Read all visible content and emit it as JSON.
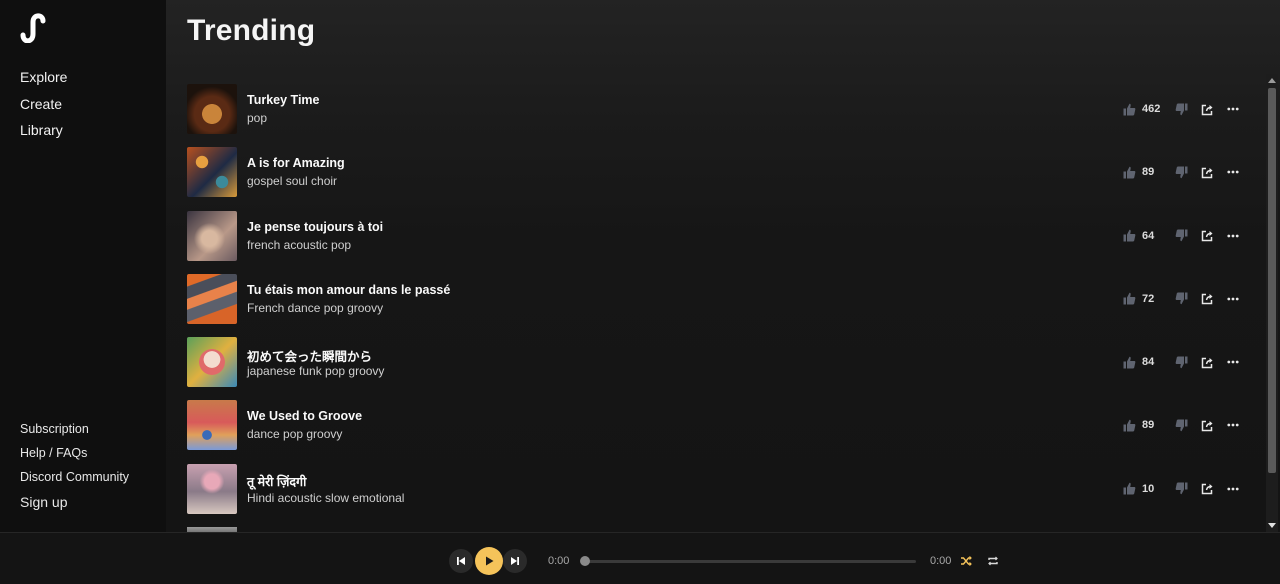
{
  "sidebar": {
    "nav": [
      {
        "label": "Explore"
      },
      {
        "label": "Create"
      },
      {
        "label": "Library"
      }
    ],
    "footer": [
      {
        "label": "Subscription"
      },
      {
        "label": "Help / FAQs"
      },
      {
        "label": "Discord Community"
      },
      {
        "label": "Sign up"
      }
    ]
  },
  "main": {
    "title": "Trending",
    "songs": [
      {
        "title": "Turkey Time",
        "genre": "pop",
        "likes": "462"
      },
      {
        "title": "A is for Amazing",
        "genre": "gospel soul choir",
        "likes": "89"
      },
      {
        "title": "Je pense toujours à toi",
        "genre": "french acoustic pop",
        "likes": "64"
      },
      {
        "title": "Tu étais mon amour dans le passé",
        "genre": "French dance pop groovy",
        "likes": "72"
      },
      {
        "title": "初めて会った瞬間から",
        "genre": "japanese funk pop groovy",
        "likes": "84"
      },
      {
        "title": "We Used to Groove",
        "genre": "dance pop groovy",
        "likes": "89"
      },
      {
        "title": "तू मेरी ज़िंदगी",
        "genre": "Hindi acoustic slow emotional",
        "likes": "10"
      }
    ]
  },
  "player": {
    "current_time": "0:00",
    "total_time": "0:00",
    "progress": 0
  },
  "colors": {
    "accent": "#f5c35a",
    "background": "#141414",
    "sidebar": "#0f0f0f"
  }
}
